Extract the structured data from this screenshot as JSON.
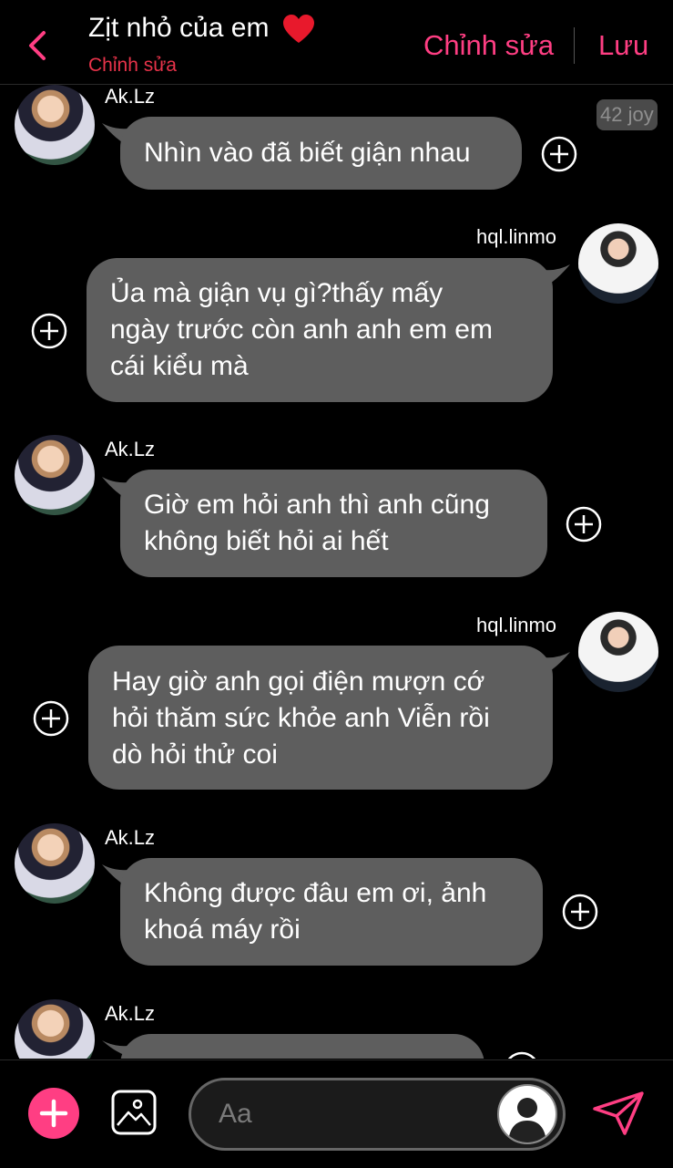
{
  "header": {
    "title": "Zịt nhỏ của em",
    "subtitle": "Chỉnh sửa",
    "edit_label": "Chỉnh sửa",
    "save_label": "Lưu",
    "accent": "#ff3e83",
    "subtitle_color": "#e8334a"
  },
  "badge": "42 joy",
  "messages": [
    {
      "sender": "Ak.Lz",
      "text": "Nhìn vào đã biết giận nhau"
    },
    {
      "sender": "hql.linmo",
      "lines": [
        "Ủa mà giận vụ gì?thấy mấy",
        "ngày trước còn anh anh em em",
        "cái kiểu mà"
      ]
    },
    {
      "sender": "Ak.Lz",
      "lines": [
        "Giờ em hỏi anh thì anh cũng",
        "không biết hỏi ai hết"
      ]
    },
    {
      "sender": "hql.linmo",
      "lines": [
        "Hay giờ anh gọi điện mượn cớ",
        "hỏi thăm sức khỏe anh Viễn rồi",
        "dò hỏi thử coi"
      ]
    },
    {
      "sender": "Ak.Lz",
      "lines": [
        "Không được đâu em ơi, ảnh",
        "khoá máy rồi"
      ]
    },
    {
      "sender": "Ak.Lz",
      "text": ""
    }
  ],
  "composer": {
    "placeholder": "Aa"
  }
}
